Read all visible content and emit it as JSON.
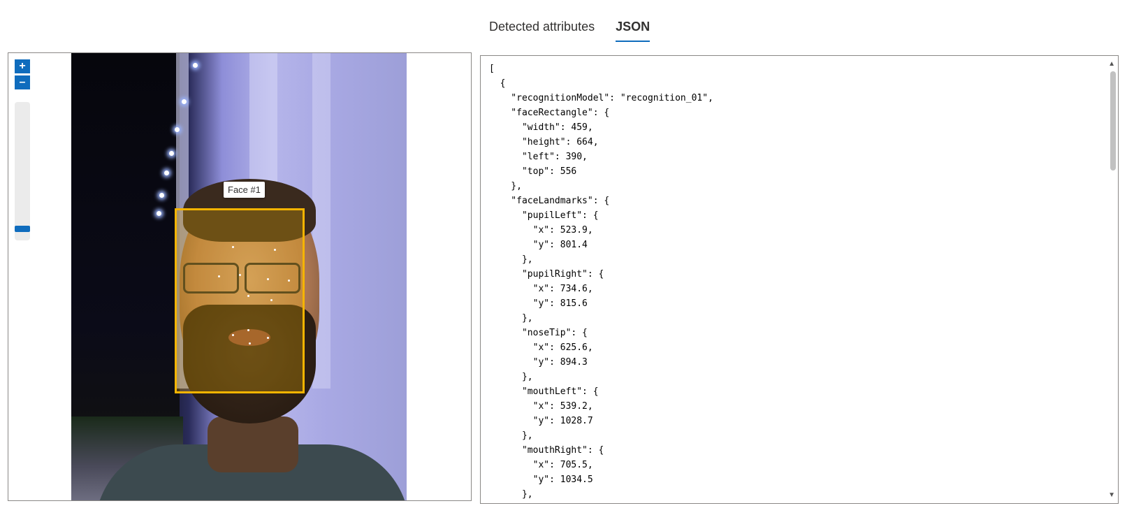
{
  "tabs": [
    {
      "label": "Detected attributes",
      "active": false
    },
    {
      "label": "JSON",
      "active": true
    }
  ],
  "viewer": {
    "zoom_in_label": "+",
    "zoom_out_label": "–",
    "face_label": "Face #1",
    "box_color": "#f5b400"
  },
  "json_text": "[\n  {\n    \"recognitionModel\": \"recognition_01\",\n    \"faceRectangle\": {\n      \"width\": 459,\n      \"height\": 664,\n      \"left\": 390,\n      \"top\": 556\n    },\n    \"faceLandmarks\": {\n      \"pupilLeft\": {\n        \"x\": 523.9,\n        \"y\": 801.4\n      },\n      \"pupilRight\": {\n        \"x\": 734.6,\n        \"y\": 815.6\n      },\n      \"noseTip\": {\n        \"x\": 625.6,\n        \"y\": 894.3\n      },\n      \"mouthLeft\": {\n        \"x\": 539.2,\n        \"y\": 1028.7\n      },\n      \"mouthRight\": {\n        \"x\": 705.5,\n        \"y\": 1034.5\n      },",
  "colors": {
    "accent": "#0f6cbd",
    "face_box": "#f5b400"
  }
}
